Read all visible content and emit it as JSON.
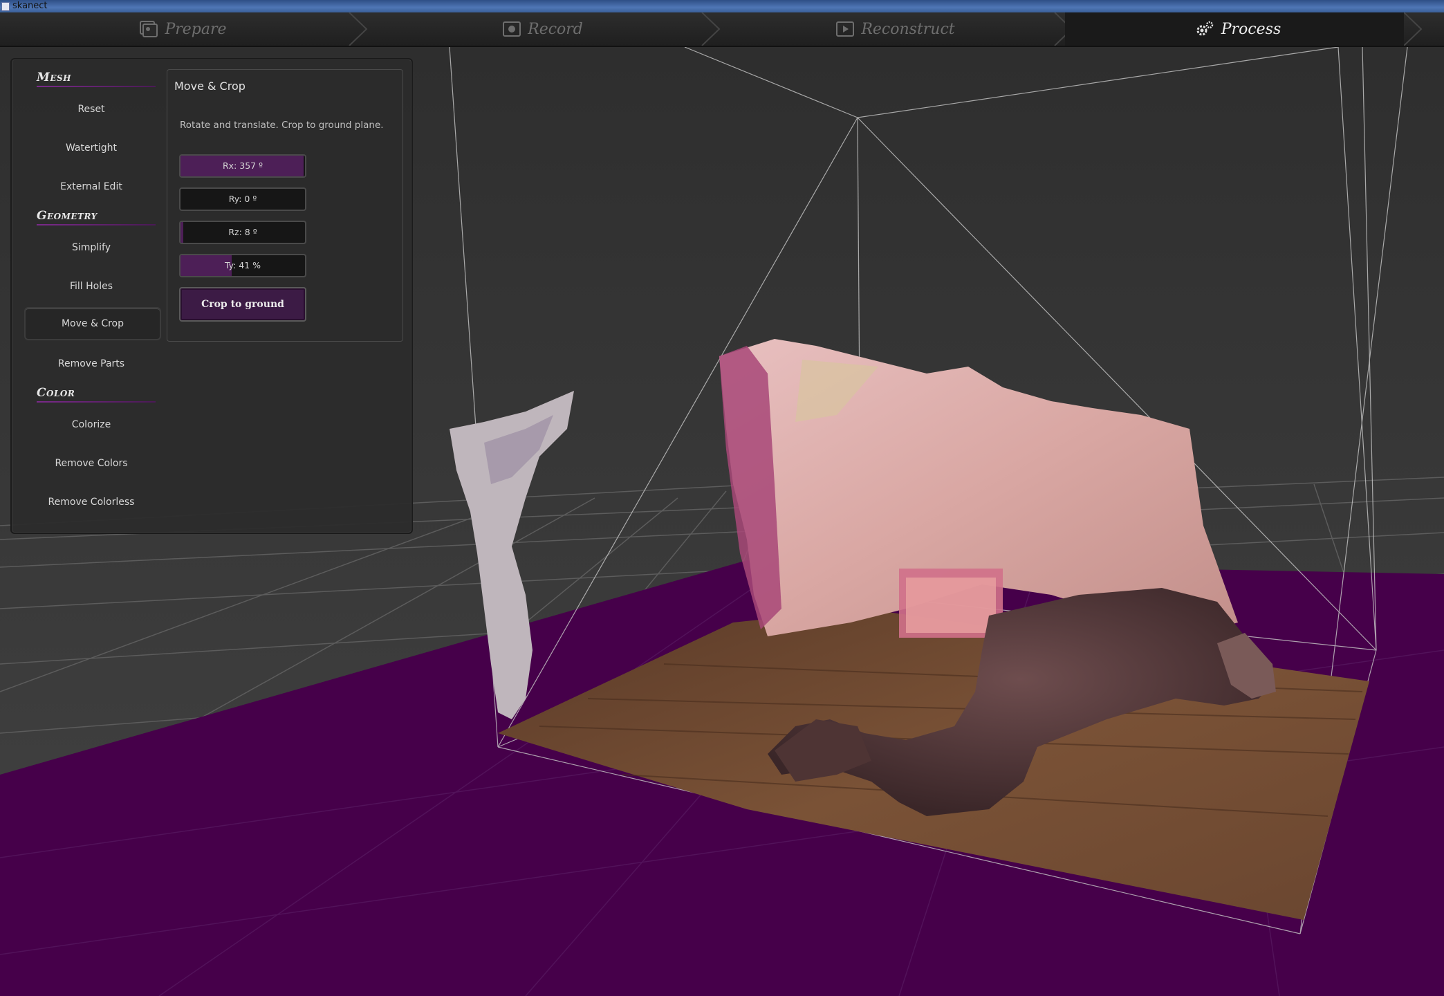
{
  "window": {
    "title": "skanect"
  },
  "stages": [
    {
      "label": "Prepare",
      "icon": "prepare-icon",
      "active": false
    },
    {
      "label": "Record",
      "icon": "camera-icon",
      "active": false
    },
    {
      "label": "Reconstruct",
      "icon": "film-icon",
      "active": false
    },
    {
      "label": "Process",
      "icon": "gears-icon",
      "active": true
    }
  ],
  "sidebar": {
    "mesh": {
      "header": "Mesh",
      "items": [
        "Reset",
        "Watertight",
        "External Edit"
      ]
    },
    "geometry": {
      "header": "Geometry",
      "items": [
        "Simplify",
        "Fill Holes",
        "Move & Crop",
        "Remove Parts"
      ],
      "selected": "Move & Crop"
    },
    "color": {
      "header": "Color",
      "items": [
        "Colorize",
        "Remove Colors",
        "Remove Colorless"
      ]
    }
  },
  "move_crop": {
    "title": "Move & Crop",
    "description": "Rotate and translate. Crop to ground plane.",
    "sliders": [
      {
        "label": "Rx: 357 º",
        "fraction": 0.99
      },
      {
        "label": "Ry: 0 º",
        "fraction": 0.0
      },
      {
        "label": "Rz: 8 º",
        "fraction": 0.02
      },
      {
        "label": "Ty: 41 %",
        "fraction": 0.41
      }
    ],
    "crop_button": "Crop to ground"
  },
  "colors": {
    "accent": "#4d1f57",
    "ground": "#46004a",
    "background": "#3a3a3a"
  }
}
